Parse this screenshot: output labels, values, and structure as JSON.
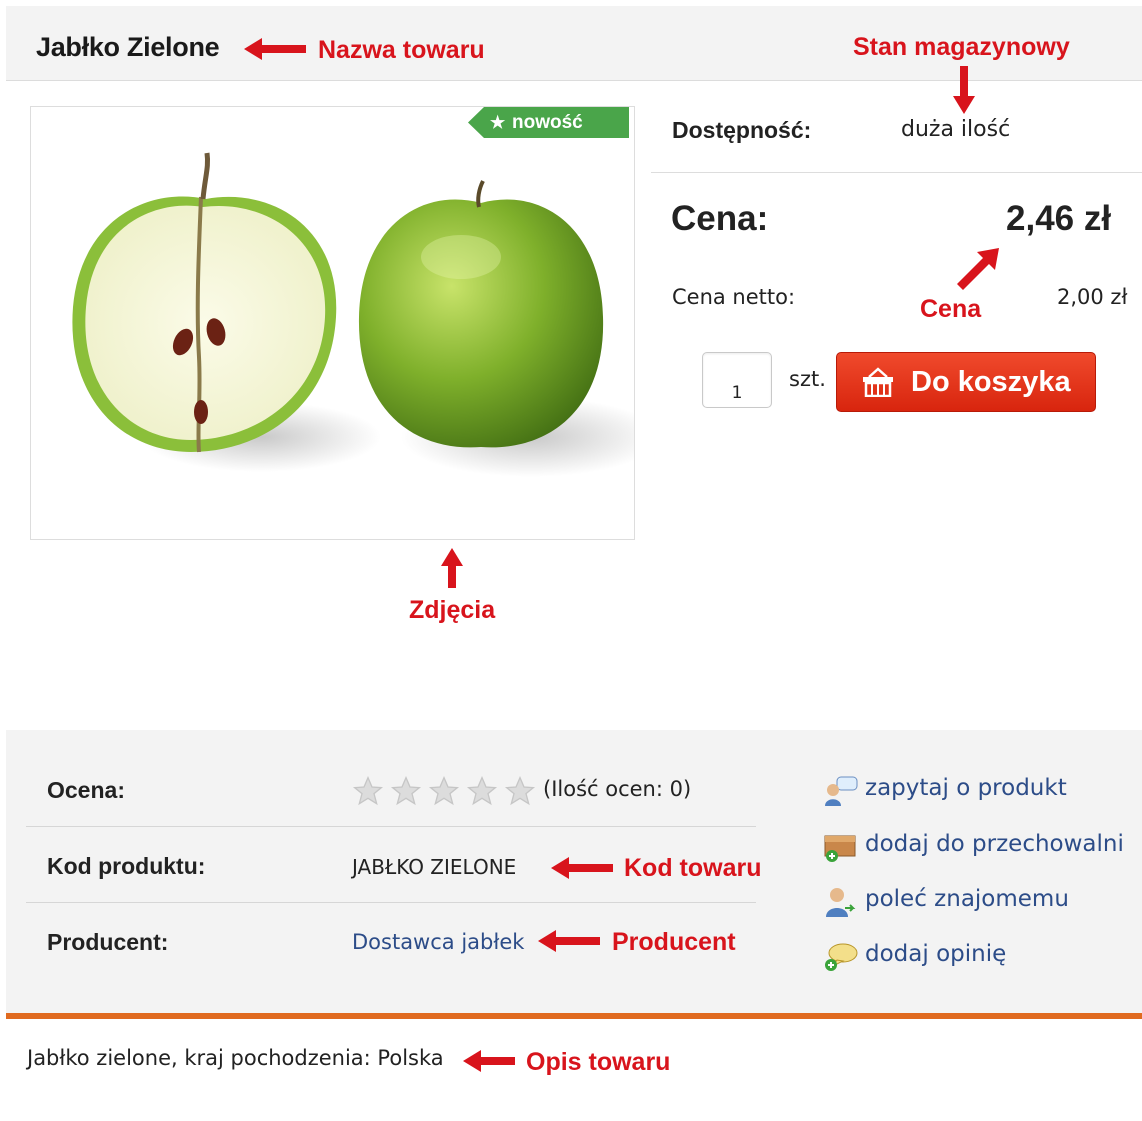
{
  "product": {
    "name": "Jabłko Zielone",
    "badge": "nowość",
    "availability_label": "Dostępność:",
    "availability_value": "duża ilość",
    "price_label": "Cena:",
    "price_value": "2,46 zł",
    "net_label": "Cena netto:",
    "net_value": "2,00 zł",
    "quantity": "1",
    "unit": "szt.",
    "add_to_cart": "Do koszyka",
    "description": "Jabłko zielone, kraj pochodzenia: Polska"
  },
  "details": {
    "rating_label": "Ocena:",
    "rating_text": "(Ilość ocen: 0)",
    "rating_stars": 0,
    "rating_max": 5,
    "code_label": "Kod produktu:",
    "code_value": "JABŁKO ZIELONE",
    "producer_label": "Producent:",
    "producer_value": "Dostawca jabłek"
  },
  "actions": [
    {
      "label": "zapytaj o produkt",
      "icon": "question-person-icon"
    },
    {
      "label": "dodaj do przechowalni",
      "icon": "storage-box-add-icon"
    },
    {
      "label": "poleć znajomemu",
      "icon": "recommend-person-icon"
    },
    {
      "label": "dodaj opinię",
      "icon": "add-comment-icon"
    }
  ],
  "annotations": {
    "name": "Nazwa towaru",
    "stock": "Stan magazynowy",
    "price": "Cena",
    "photos": "Zdjęcia",
    "code": "Kod towaru",
    "producer": "Producent",
    "description": "Opis towaru"
  },
  "colors": {
    "annotation_red": "#d8141c",
    "badge_green": "#4aa54a",
    "cart_red": "#e0341a",
    "accent_orange": "#e06a1f",
    "link_blue": "#2c4c88"
  }
}
